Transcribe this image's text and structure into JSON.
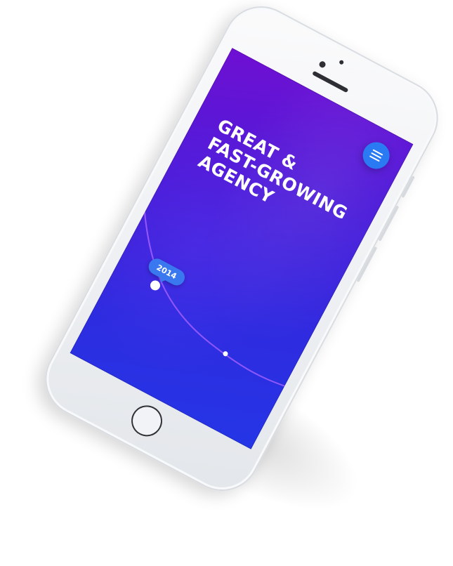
{
  "headline": {
    "lines": [
      "GREAT &",
      "FAST-GROWING",
      "AGENCY"
    ]
  },
  "menu": {
    "icon": "hamburger-menu-icon",
    "color": "#2a7bf3"
  },
  "timeline": {
    "badge_label": "2014"
  },
  "colors": {
    "screen_gradient_start": "#6f10d3",
    "screen_gradient_end": "#2436e6",
    "badge": "#3a78ef",
    "timeline_line": "#9b5cff"
  }
}
